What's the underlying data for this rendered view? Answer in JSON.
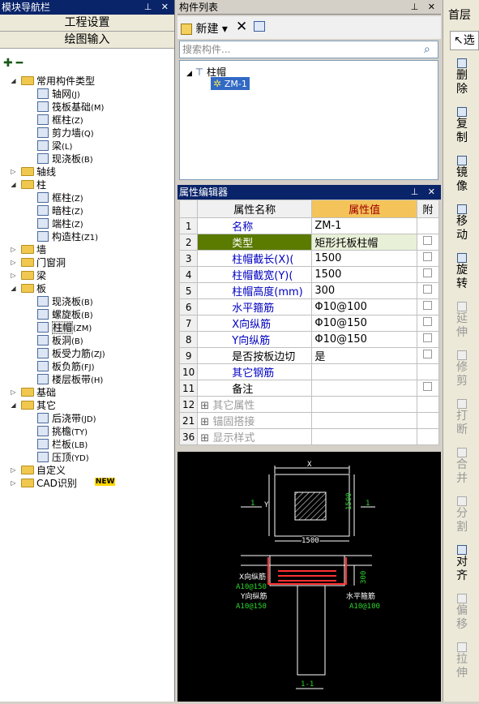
{
  "nav": {
    "title": "模块导航栏",
    "btn_project": "工程设置",
    "btn_draw": "绘图输入",
    "toolbar_add": "+",
    "toolbar_remove": "−",
    "tree": [
      {
        "label": "常用构件类型",
        "level": 0,
        "expanded": true,
        "type": "folder"
      },
      {
        "label": "轴网",
        "code": "(J)",
        "level": 1,
        "icon": "grid-icon"
      },
      {
        "label": "筏板基础",
        "code": "(M)",
        "level": 1,
        "icon": "raft-foundation-icon"
      },
      {
        "label": "框柱",
        "code": "(Z)",
        "level": 1,
        "icon": "column-icon"
      },
      {
        "label": "剪力墙",
        "code": "(Q)",
        "level": 1,
        "icon": "shear-wall-icon"
      },
      {
        "label": "梁",
        "code": "(L)",
        "level": 1,
        "icon": "beam-icon"
      },
      {
        "label": "现浇板",
        "code": "(B)",
        "level": 1,
        "icon": "slab-icon"
      },
      {
        "label": "轴线",
        "level": 0,
        "expanded": false,
        "type": "folder"
      },
      {
        "label": "柱",
        "level": 0,
        "expanded": true,
        "type": "folder"
      },
      {
        "label": "框柱",
        "code": "(Z)",
        "level": 1,
        "icon": "column-icon"
      },
      {
        "label": "暗柱",
        "code": "(Z)",
        "level": 1,
        "icon": "hidden-column-icon"
      },
      {
        "label": "端柱",
        "code": "(Z)",
        "level": 1,
        "icon": "end-column-icon"
      },
      {
        "label": "构造柱",
        "code": "(Z1)",
        "level": 1,
        "icon": "construct-column-icon"
      },
      {
        "label": "墙",
        "level": 0,
        "expanded": false,
        "type": "folder"
      },
      {
        "label": "门窗洞",
        "level": 0,
        "expanded": false,
        "type": "folder"
      },
      {
        "label": "梁",
        "level": 0,
        "expanded": false,
        "type": "folder"
      },
      {
        "label": "板",
        "level": 0,
        "expanded": true,
        "type": "folder"
      },
      {
        "label": "现浇板",
        "code": "(B)",
        "level": 1,
        "icon": "slab-icon"
      },
      {
        "label": "螺旋板",
        "code": "(B)",
        "level": 1,
        "icon": "spiral-slab-icon"
      },
      {
        "label": "柱帽",
        "code": "(ZM)",
        "level": 1,
        "icon": "column-cap-icon",
        "selected": true
      },
      {
        "label": "板洞",
        "code": "(B)",
        "level": 1,
        "icon": "slab-hole-icon"
      },
      {
        "label": "板受力筋",
        "code": "(ZJ)",
        "level": 1,
        "icon": "slab-rebar-icon"
      },
      {
        "label": "板负筋",
        "code": "(FJ)",
        "level": 1,
        "icon": "slab-neg-rebar-icon"
      },
      {
        "label": "楼层板带",
        "code": "(H)",
        "level": 1,
        "icon": "floor-strip-icon"
      },
      {
        "label": "基础",
        "level": 0,
        "expanded": false,
        "type": "folder"
      },
      {
        "label": "其它",
        "level": 0,
        "expanded": true,
        "type": "folder"
      },
      {
        "label": "后浇带",
        "code": "(JD)",
        "level": 1,
        "icon": "post-pour-icon"
      },
      {
        "label": "挑檐",
        "code": "(TY)",
        "level": 1,
        "icon": "eave-icon"
      },
      {
        "label": "栏板",
        "code": "(LB)",
        "level": 1,
        "icon": "parapet-icon"
      },
      {
        "label": "压顶",
        "code": "(YD)",
        "level": 1,
        "icon": "coping-icon"
      },
      {
        "label": "自定义",
        "level": 0,
        "expanded": false,
        "type": "folder"
      },
      {
        "label": "CAD识别",
        "level": 0,
        "expanded": false,
        "type": "folder",
        "badge": "NEW"
      }
    ]
  },
  "complist": {
    "title": "构件列表",
    "new_label": "新建",
    "search_placeholder": "搜索构件...",
    "tree_parent": "柱帽",
    "tree_child": "ZM-1"
  },
  "props": {
    "title": "属性编辑器",
    "col_name": "属性名称",
    "col_value": "属性值",
    "col_extra": "附",
    "rows": [
      {
        "num": "1",
        "name": "名称",
        "value": "ZM-1",
        "blue": true,
        "check": false
      },
      {
        "num": "2",
        "name": "类型",
        "value": "矩形托板柱帽",
        "blue": false,
        "check": true,
        "selected": true
      },
      {
        "num": "3",
        "name": "柱帽截长(X)(",
        "value": "1500",
        "blue": true,
        "check": true
      },
      {
        "num": "4",
        "name": "柱帽截宽(Y)(",
        "value": "1500",
        "blue": true,
        "check": true
      },
      {
        "num": "5",
        "name": "柱帽高度(mm)",
        "value": "300",
        "blue": true,
        "check": true
      },
      {
        "num": "6",
        "name": "水平箍筋",
        "value": "Φ10@100",
        "blue": true,
        "check": true
      },
      {
        "num": "7",
        "name": "X向纵筋",
        "value": "Φ10@150",
        "blue": true,
        "check": true
      },
      {
        "num": "8",
        "name": "Y向纵筋",
        "value": "Φ10@150",
        "blue": true,
        "check": true
      },
      {
        "num": "9",
        "name": "是否按板边切",
        "value": "是",
        "blue": false,
        "check": true
      },
      {
        "num": "10",
        "name": "其它钢筋",
        "value": "",
        "blue": true,
        "check": false
      },
      {
        "num": "11",
        "name": "备注",
        "value": "",
        "blue": false,
        "check": true
      },
      {
        "num": "12",
        "name": "其它属性",
        "value": "",
        "grey": true,
        "group": true
      },
      {
        "num": "21",
        "name": "锚固搭接",
        "value": "",
        "grey": true,
        "group": true
      },
      {
        "num": "36",
        "name": "显示样式",
        "value": "",
        "grey": true,
        "group": true
      }
    ]
  },
  "preview": {
    "dim_x": "X",
    "dim_y": "Y",
    "dim_1500_h": "1500",
    "dim_1500_v": "1500",
    "section_mark": "1",
    "label_x_rebar": "X向纵筋",
    "label_x_rebar_spec": "A10@150",
    "label_y_rebar": "Y向纵筋",
    "label_y_rebar_spec": "A10@150",
    "label_h_stirrup": "水平箍筋",
    "label_h_stirrup_spec": "A10@100",
    "dim_300": "300",
    "section_label": "1-1"
  },
  "rtool": {
    "tab_floor": "首层",
    "tab_select": "选",
    "buttons": [
      {
        "label": "删除",
        "icon": "delete-icon",
        "enabled": true
      },
      {
        "label": "复制",
        "icon": "copy-icon",
        "enabled": true
      },
      {
        "label": "镜像",
        "icon": "mirror-icon",
        "enabled": true
      },
      {
        "label": "移动",
        "icon": "move-icon",
        "enabled": true
      },
      {
        "label": "旋转",
        "icon": "rotate-icon",
        "enabled": true
      },
      {
        "label": "延伸",
        "icon": "extend-icon",
        "enabled": false
      },
      {
        "label": "修剪",
        "icon": "trim-icon",
        "enabled": false
      },
      {
        "label": "打断",
        "icon": "break-icon",
        "enabled": false
      },
      {
        "label": "合并",
        "icon": "merge-icon",
        "enabled": false
      },
      {
        "label": "分割",
        "icon": "split-icon",
        "enabled": false
      },
      {
        "label": "对齐",
        "icon": "align-icon",
        "enabled": true
      },
      {
        "label": "偏移",
        "icon": "offset-icon",
        "enabled": false
      },
      {
        "label": "拉伸",
        "icon": "stretch-icon",
        "enabled": false
      }
    ]
  }
}
